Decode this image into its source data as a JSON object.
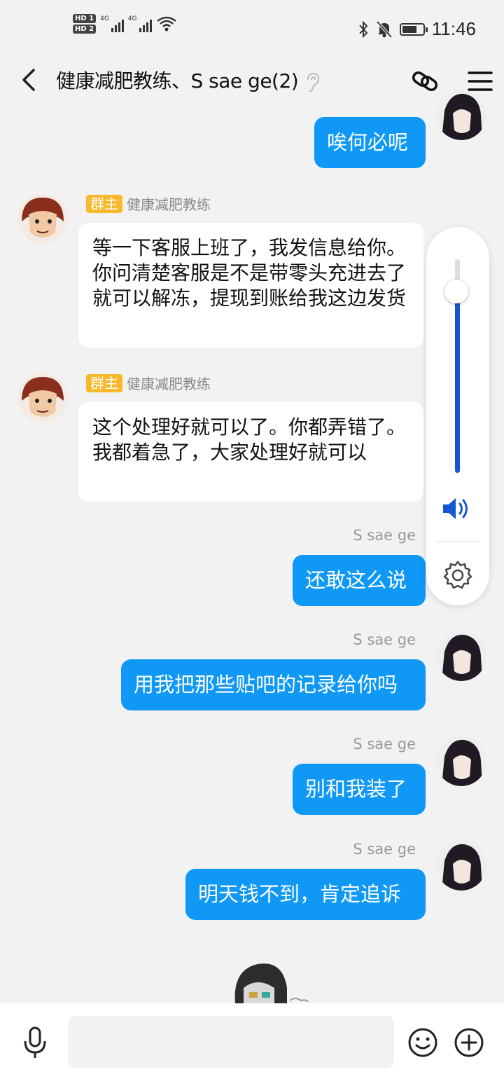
{
  "status_bar": {
    "sim1_label": "HD 1",
    "sim2_label": "HD 2",
    "network1": "4G",
    "network2": "4G",
    "time": "11:46",
    "icons": [
      "bluetooth-icon",
      "mute-icon",
      "battery-icon",
      "wifi-icon"
    ]
  },
  "header": {
    "title": "健康减肥教练、S sae ge(2)",
    "icons": [
      "back-arrow-icon",
      "ear-icon",
      "link-icon",
      "menu-icon"
    ]
  },
  "messages": [
    {
      "side": "out",
      "text": "唉何必呢"
    },
    {
      "side": "in",
      "sender": "健康减肥教练",
      "role_badge": "群主",
      "text": "等一下客服上班了，我发信息给你。你问清楚客服是不是带零头充进去了就可以解冻，提现到账给我这边发货"
    },
    {
      "side": "in",
      "sender": "健康减肥教练",
      "role_badge": "群主",
      "text": "这个处理好就可以了。你都弄错了。我都着急了，大家处理好就可以"
    },
    {
      "side": "out",
      "sender": "S sae ge",
      "text": "还敢这么说"
    },
    {
      "side": "out",
      "sender": "S sae ge",
      "text": "用我把那些贴吧的记录给你吗"
    },
    {
      "side": "out",
      "sender": "S sae ge",
      "text": "别和我装了"
    },
    {
      "side": "out",
      "sender": "S sae ge",
      "text": "明天钱不到，肯定追诉"
    }
  ],
  "volume_panel": {
    "level": 0.85,
    "icons": [
      "volume-icon",
      "settings-gear-icon"
    ],
    "accent_color": "#1556d4"
  },
  "input_bar": {
    "placeholder": "",
    "icons": [
      "microphone-icon",
      "emoji-icon",
      "add-icon"
    ]
  },
  "colors": {
    "outgoing_bubble": "#0f98f5",
    "incoming_bubble": "#ffffff",
    "owner_badge": "#f8b92c",
    "background": "#f2f2f2"
  }
}
